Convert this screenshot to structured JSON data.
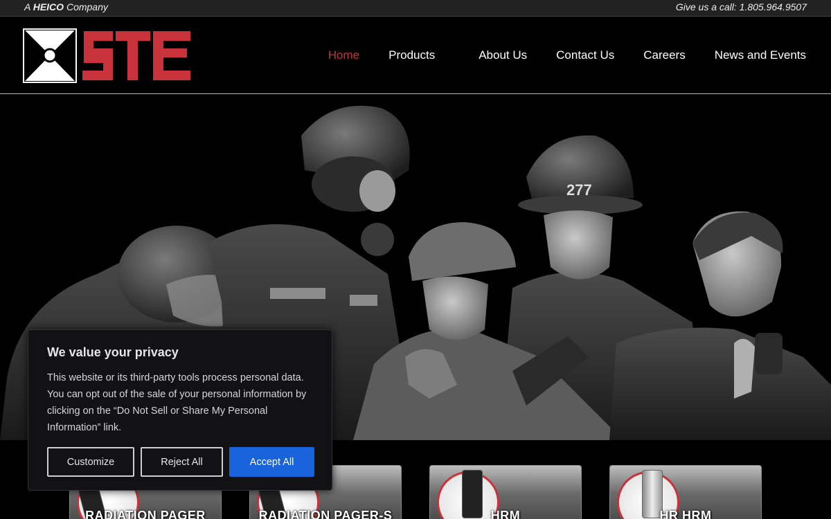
{
  "topbar": {
    "prefix": "A",
    "company": "HEICO",
    "suffix": "Company",
    "phone_label": "Give us a call:  1.805.964.9507"
  },
  "logo": {
    "text": "STE",
    "brand_color": "#c8323a"
  },
  "nav": {
    "items": [
      {
        "label": "Home",
        "active": true
      },
      {
        "label": "Products"
      },
      {
        "label": "About Us"
      },
      {
        "label": "Contact Us"
      },
      {
        "label": "Careers"
      },
      {
        "label": "News and Events"
      }
    ]
  },
  "hero": {
    "helmet_number": "277"
  },
  "products": [
    {
      "label": "RADIATION PAGER"
    },
    {
      "label": "RADIATION PAGER-S"
    },
    {
      "label": "HRM"
    },
    {
      "label": "HR HRM"
    }
  ],
  "consent": {
    "title": "We value your privacy",
    "body": "This website or its third-party tools process personal data. You can opt out of the sale of your personal information by clicking on the “Do Not Sell or Share My Personal Information” link.",
    "customize_label": "Customize",
    "reject_label": "Reject All",
    "accept_label": "Accept All",
    "accept_color": "#1863dc"
  }
}
